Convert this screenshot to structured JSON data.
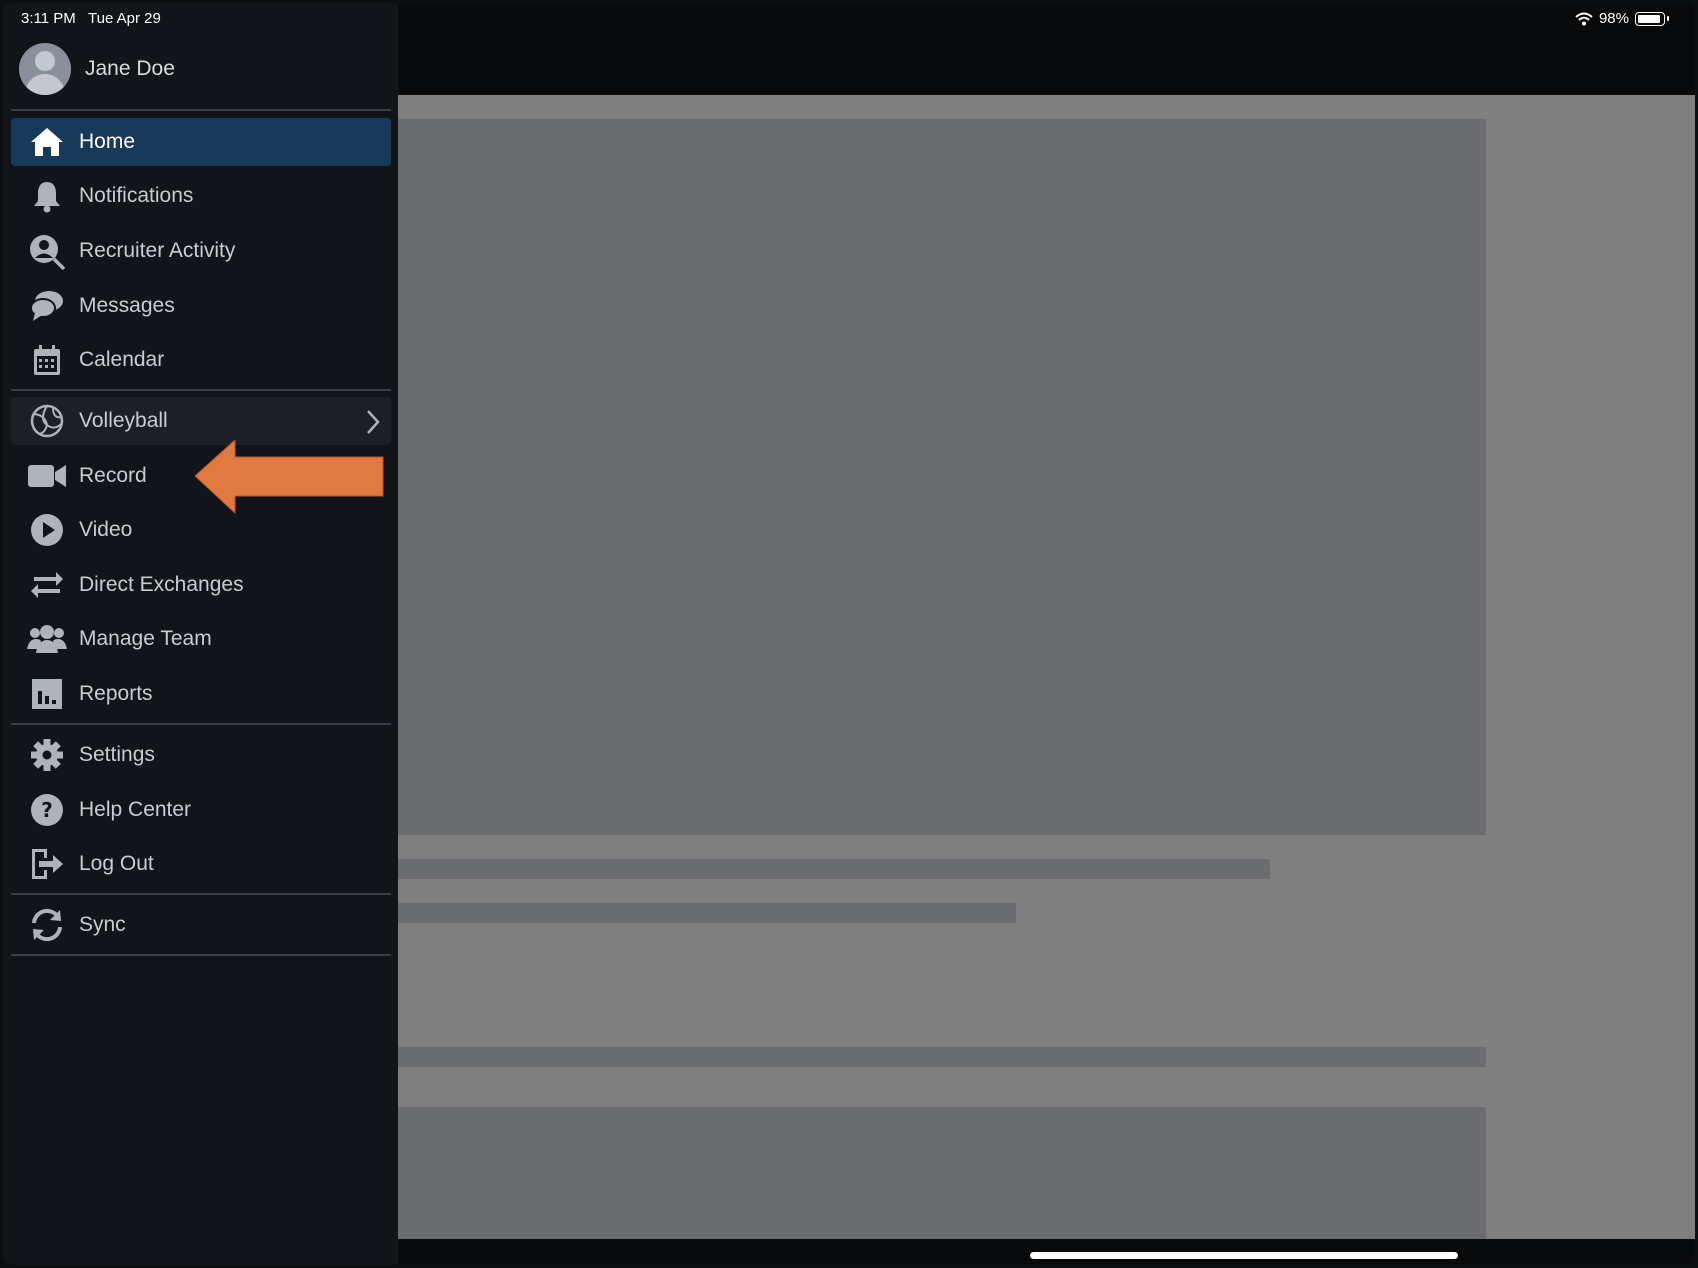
{
  "status_bar": {
    "time": "3:11 PM",
    "date": "Tue Apr 29",
    "battery": "98%"
  },
  "user": {
    "name": "Jane Doe",
    "avatar_icon": "user-avatar-icon"
  },
  "nav": {
    "primary": [
      {
        "label": "Home",
        "icon": "home-icon",
        "active": true
      },
      {
        "label": "Notifications",
        "icon": "bell-icon"
      },
      {
        "label": "Recruiter Activity",
        "icon": "recruiter-search-icon"
      },
      {
        "label": "Messages",
        "icon": "chat-bubbles-icon"
      },
      {
        "label": "Calendar",
        "icon": "calendar-icon"
      }
    ],
    "sport": {
      "label": "Volleyball",
      "icon": "volleyball-icon"
    },
    "secondary": [
      {
        "label": "Record",
        "icon": "video-camera-icon"
      },
      {
        "label": "Video",
        "icon": "play-circle-icon"
      },
      {
        "label": "Direct Exchanges",
        "icon": "exchange-arrows-icon"
      },
      {
        "label": "Manage Team",
        "icon": "team-icon"
      },
      {
        "label": "Reports",
        "icon": "bar-chart-icon"
      }
    ],
    "utility": [
      {
        "label": "Settings",
        "icon": "gear-icon"
      },
      {
        "label": "Help Center",
        "icon": "question-circle-icon"
      },
      {
        "label": "Log Out",
        "icon": "logout-icon"
      }
    ],
    "sync": {
      "label": "Sync",
      "icon": "sync-icon"
    }
  },
  "colors": {
    "sidebar_bg": "#111418",
    "active_bg": "#173a58",
    "content_bg": "#7f7f80",
    "annotation_arrow": "#e07a40"
  }
}
